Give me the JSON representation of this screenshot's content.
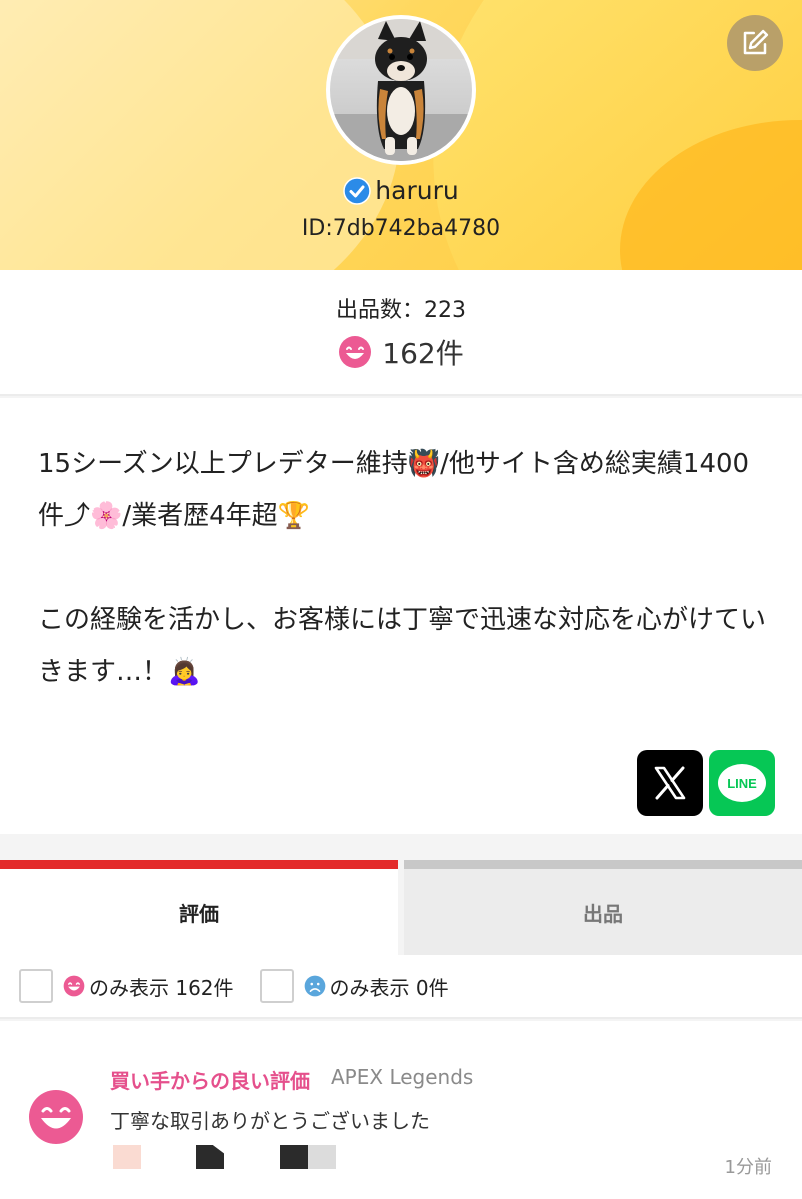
{
  "profile": {
    "username": "haruru",
    "id_label": "ID:7db742ba4780",
    "listing_count_label": "出品数：223",
    "rating_count": "162件",
    "bio": "15シーズン以上プレデター維持👹/他サイト含め総実績1400件⤴︎🌸/業者歴4年超🏆\n\nこの経験を活かし、お客様には丁寧で迅速な対応を心がけていきます…！🙇‍♀️"
  },
  "social": {
    "x_icon": "x-logo",
    "line_label": "LINE"
  },
  "tabs": [
    {
      "label": "評価",
      "active": true
    },
    {
      "label": "出品",
      "active": false
    }
  ],
  "filters": [
    {
      "icon": "happy-face-icon",
      "label": "のみ表示 162件",
      "checked": false
    },
    {
      "icon": "sad-face-icon",
      "label": "のみ表示 0件",
      "checked": false
    }
  ],
  "review": {
    "title": "買い手からの良い評価",
    "game": "APEX Legends",
    "body": "丁寧な取引ありがとうございました",
    "time": "1分前"
  },
  "colors": {
    "accent_red": "#e32b2b",
    "pink": "#e5508c",
    "line_green": "#06c755",
    "header_yellow": "#ffd85e"
  }
}
